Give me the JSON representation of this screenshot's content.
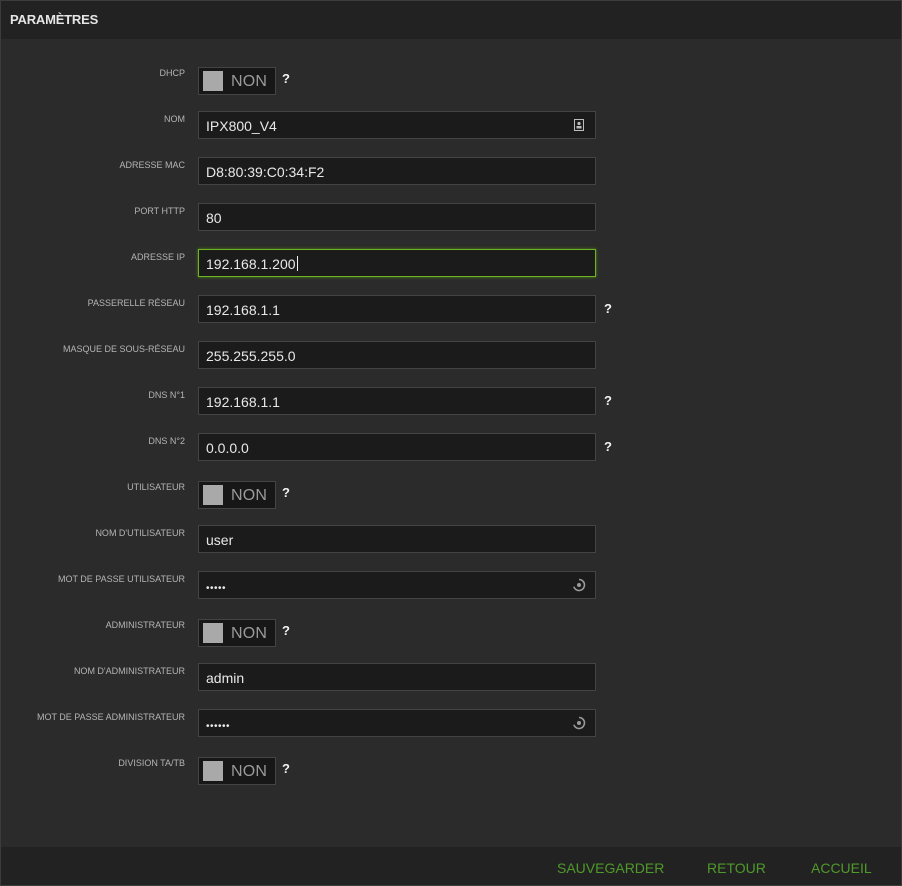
{
  "header": {
    "title": "PARAMÈTRES"
  },
  "form": {
    "dhcp": {
      "label": "DHCP",
      "state": "NON",
      "help": "?"
    },
    "nom": {
      "label": "NOM",
      "value": "IPX800_V4"
    },
    "adresse_mac": {
      "label": "ADRESSE MAC",
      "value": "D8:80:39:C0:34:F2"
    },
    "port_http": {
      "label": "PORT HTTP",
      "value": "80"
    },
    "adresse_ip": {
      "label": "ADRESSE IP",
      "value": "192.168.1.200"
    },
    "passerelle": {
      "label": "PASSERELLE RÉSEAU",
      "value": "192.168.1.1",
      "help": "?"
    },
    "masque": {
      "label": "MASQUE DE SOUS-RÉSEAU",
      "value": "255.255.255.0"
    },
    "dns1": {
      "label": "DNS N°1",
      "value": "192.168.1.1",
      "help": "?"
    },
    "dns2": {
      "label": "DNS N°2",
      "value": "0.0.0.0",
      "help": "?"
    },
    "utilisateur": {
      "label": "UTILISATEUR",
      "state": "NON",
      "help": "?"
    },
    "nom_utilisateur": {
      "label": "NOM D'UTILISATEUR",
      "value": "user"
    },
    "mdp_utilisateur": {
      "label": "MOT DE PASSE UTILISATEUR",
      "value": "•••••"
    },
    "administrateur": {
      "label": "ADMINISTRATEUR",
      "state": "NON",
      "help": "?"
    },
    "nom_admin": {
      "label": "NOM D'ADMINISTRATEUR",
      "value": "admin"
    },
    "mdp_admin": {
      "label": "MOT DE PASSE ADMINISTRATEUR",
      "value": "••••••"
    },
    "division": {
      "label": "DIVISION TA/TB",
      "state": "NON",
      "help": "?"
    }
  },
  "footer": {
    "save": "SAUVEGARDER",
    "back": "RETOUR",
    "home": "ACCUEIL"
  },
  "colors": {
    "background": "#2b2b2b",
    "header": "#222222",
    "field": "#1b1b1b",
    "accent": "#4f9a2a",
    "focus_border": "#6fb523"
  }
}
